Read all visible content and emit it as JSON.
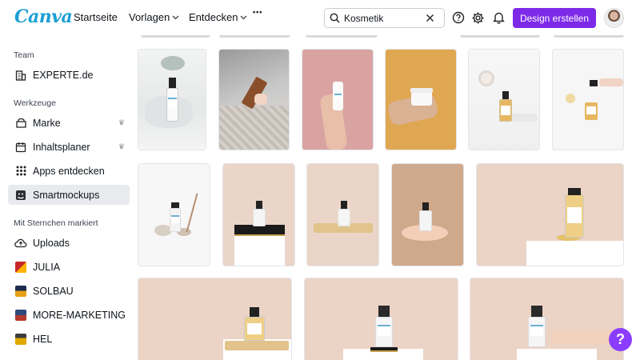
{
  "app": {
    "logo": "Canva"
  },
  "nav": {
    "startseite": "Startseite",
    "vorlagen": "Vorlagen",
    "entdecken": "Entdecken",
    "more": "•••"
  },
  "search": {
    "value": "Kosmetik"
  },
  "toolbar": {
    "create_label": "Design erstellen"
  },
  "sidebar": {
    "team_title": "Team",
    "team_item": "EXPERTE.de",
    "tools_title": "Werkzeuge",
    "tools": [
      {
        "label": "Marke"
      },
      {
        "label": "Inhaltsplaner"
      },
      {
        "label": "Apps entdecken"
      },
      {
        "label": "Smartmockups"
      }
    ],
    "starred_title": "Mit Sternchen markiert",
    "starred": [
      {
        "label": "Uploads"
      },
      {
        "label": "JULIA",
        "color": "#c62828"
      },
      {
        "label": "SOLBAU",
        "color": "#e6a117"
      },
      {
        "label": "MORE-MARKETING",
        "color": "#2e4a7a"
      },
      {
        "label": "HEL",
        "color": "#e0a700"
      }
    ]
  },
  "help_fab": "?",
  "colors": {
    "accent": "#7d2ae8",
    "active_bg": "#e8eaee"
  },
  "mockups": [
    {
      "id": "white-pump-bottle-on-marble"
    },
    {
      "id": "amber-dropper-in-hand-knit"
    },
    {
      "id": "white-tube-on-pink"
    },
    {
      "id": "jar-in-hand-on-orange"
    },
    {
      "id": "dropper-bottle-with-orchid"
    },
    {
      "id": "dropper-bottle-with-pipette"
    },
    {
      "id": "bottle-with-dried-flowers"
    },
    {
      "id": "dropper-on-black-plinth"
    },
    {
      "id": "dropper-on-gold-tray"
    },
    {
      "id": "bottle-on-palm"
    },
    {
      "id": "large-serum-bottle-beige"
    },
    {
      "id": "dropper-on-gold-tray-wide"
    },
    {
      "id": "spray-bottle-on-stand"
    },
    {
      "id": "spray-bottle-in-hand"
    }
  ]
}
